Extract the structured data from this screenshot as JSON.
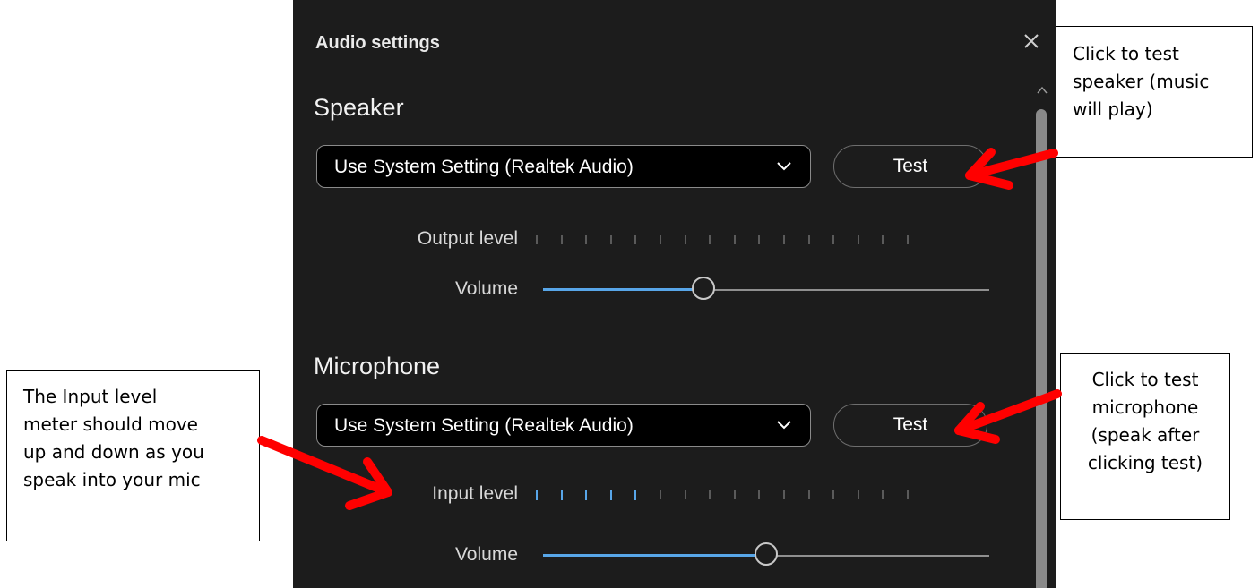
{
  "dialog": {
    "title": "Audio settings",
    "close_icon": "close-icon"
  },
  "speaker": {
    "heading": "Speaker",
    "device": "Use System Setting (Realtek Audio)",
    "test_label": "Test",
    "meter_label": "Output level",
    "meter_ticks_total": 16,
    "meter_ticks_active": 0,
    "volume_label": "Volume",
    "volume_fraction": 0.36
  },
  "microphone": {
    "heading": "Microphone",
    "device": "Use System Setting (Realtek Audio)",
    "test_label": "Test",
    "meter_label": "Input level",
    "meter_ticks_total": 16,
    "meter_ticks_active": 5,
    "volume_label": "Volume",
    "volume_fraction": 0.5
  },
  "callouts": {
    "speaker_test": [
      "Click to test",
      "speaker (music",
      "will play)"
    ],
    "mic_test": [
      "Click to test",
      "microphone",
      "(speak after",
      "clicking test)"
    ],
    "input_meter": [
      "The Input level",
      "meter should move",
      "up and down as you",
      "speak into your mic"
    ]
  },
  "colors": {
    "panel_bg": "#1c1c1c",
    "accent": "#58a6e8",
    "annotation_arrow": "#ff0000"
  }
}
